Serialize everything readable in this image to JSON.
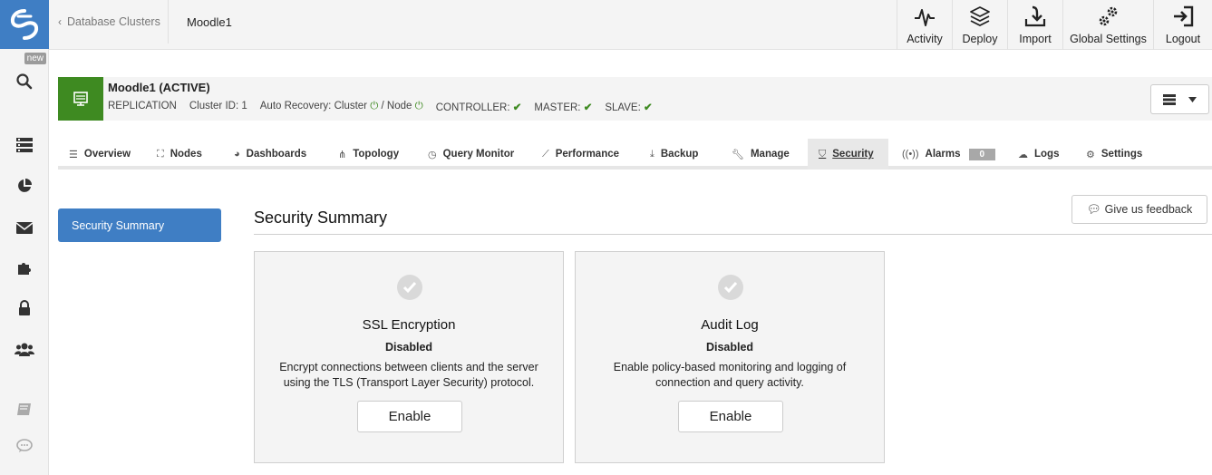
{
  "colors": {
    "brand": "#3f7ec4",
    "cluster_status": "#3e8a21",
    "ok": "#3e8a21"
  },
  "rail": {
    "badge": "new",
    "icons": [
      "logo-icon",
      "search-icon",
      "clusters-icon",
      "reports-icon",
      "mail-icon",
      "integrations-icon",
      "lock-icon",
      "users-icon",
      "docs-icon",
      "chat-icon"
    ]
  },
  "breadcrumb": {
    "back_label": "Database Clusters",
    "current": "Moodle1"
  },
  "top_actions": [
    {
      "label": "Activity",
      "icon": "activity-icon"
    },
    {
      "label": "Deploy",
      "icon": "deploy-icon"
    },
    {
      "label": "Import",
      "icon": "import-icon"
    },
    {
      "label": "Global Settings",
      "icon": "gears-icon"
    },
    {
      "label": "Logout",
      "icon": "logout-icon"
    }
  ],
  "cluster": {
    "name": "Moodle1 (ACTIVE)",
    "type": "REPLICATION",
    "cluster_id": "Cluster ID: 1",
    "auto_recovery_label": "Auto Recovery:",
    "auto_recovery_cluster": "Cluster",
    "auto_recovery_sep": "/ Node",
    "controller": "CONTROLLER:",
    "master": "MASTER:",
    "slave": "SLAVE:"
  },
  "tabs": [
    {
      "label": "Overview",
      "icon": "list-icon"
    },
    {
      "label": "Nodes",
      "icon": "sitemap-icon"
    },
    {
      "label": "Dashboards",
      "icon": "dashboard-icon"
    },
    {
      "label": "Topology",
      "icon": "topology-icon"
    },
    {
      "label": "Query Monitor",
      "icon": "query-icon"
    },
    {
      "label": "Performance",
      "icon": "chart-icon"
    },
    {
      "label": "Backup",
      "icon": "backup-icon"
    },
    {
      "label": "Manage",
      "icon": "wrench-icon"
    },
    {
      "label": "Security",
      "icon": "shield-icon",
      "active": true
    },
    {
      "label": "Alarms",
      "icon": "broadcast-icon",
      "badge": "0"
    },
    {
      "label": "Logs",
      "icon": "logs-icon"
    },
    {
      "label": "Settings",
      "icon": "gear-icon"
    }
  ],
  "sidebar": {
    "items": [
      {
        "label": "Security Summary",
        "active": true
      }
    ]
  },
  "main": {
    "title": "Security Summary",
    "feedback_label": "Give us feedback",
    "cards": [
      {
        "title": "SSL Encryption",
        "status": "Disabled",
        "description": "Encrypt connections between clients and the server using the TLS (Transport Layer Security) protocol.",
        "button": "Enable"
      },
      {
        "title": "Audit Log",
        "status": "Disabled",
        "description": "Enable policy-based monitoring and logging of connection and query activity.",
        "button": "Enable"
      }
    ]
  }
}
